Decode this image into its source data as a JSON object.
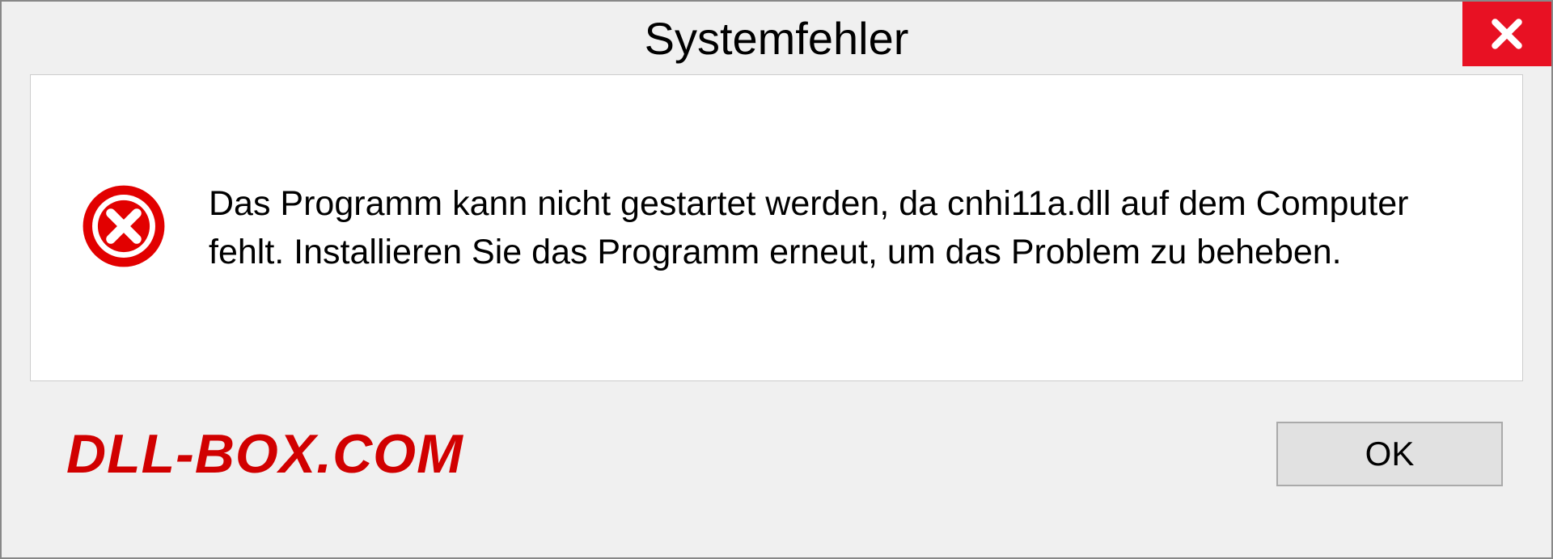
{
  "dialog": {
    "title": "Systemfehler",
    "message": "Das Programm kann nicht gestartet werden, da cnhi11a.dll auf dem Computer fehlt. Installieren Sie das Programm erneut, um das Problem zu beheben.",
    "ok_label": "OK"
  },
  "watermark": "DLL-BOX.COM"
}
